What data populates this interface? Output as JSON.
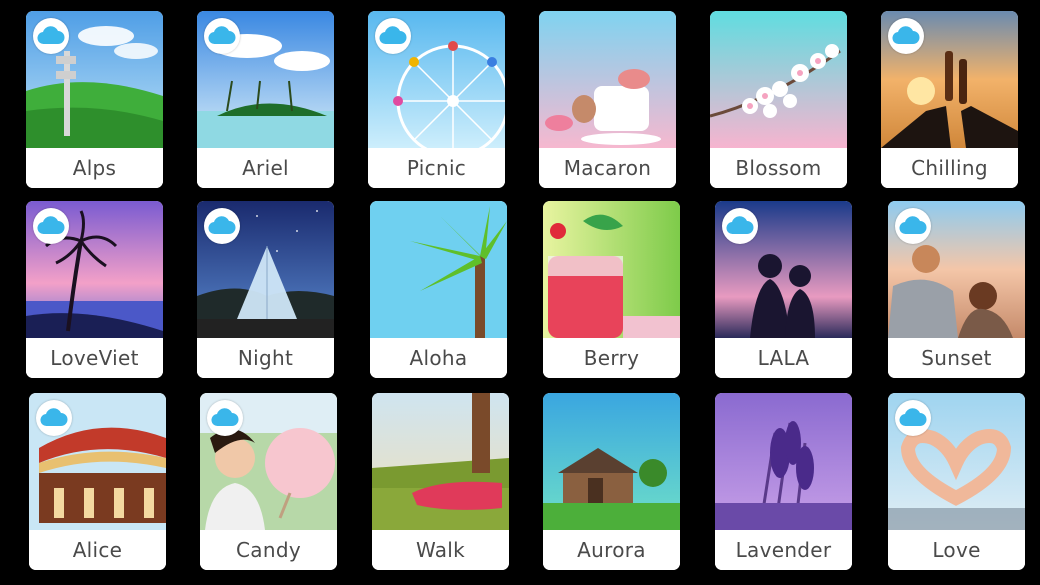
{
  "filters": [
    {
      "label": "Alps",
      "cloud": true
    },
    {
      "label": "Ariel",
      "cloud": true
    },
    {
      "label": "Picnic",
      "cloud": true
    },
    {
      "label": "Macaron",
      "cloud": false
    },
    {
      "label": "Blossom",
      "cloud": false
    },
    {
      "label": "Chilling",
      "cloud": true
    },
    {
      "label": "LoveViet",
      "cloud": true
    },
    {
      "label": "Night",
      "cloud": true
    },
    {
      "label": "Aloha",
      "cloud": false
    },
    {
      "label": "Berry",
      "cloud": false
    },
    {
      "label": "LALA",
      "cloud": true
    },
    {
      "label": "Sunset",
      "cloud": true
    },
    {
      "label": "Alice",
      "cloud": true
    },
    {
      "label": "Candy",
      "cloud": true
    },
    {
      "label": "Walk",
      "cloud": false
    },
    {
      "label": "Aurora",
      "cloud": false
    },
    {
      "label": "Lavender",
      "cloud": false
    },
    {
      "label": "Love",
      "cloud": true
    }
  ],
  "colors": {
    "cloud_icon": "#3ab6ea",
    "label_text": "#4a4a4a",
    "background": "#000000"
  }
}
